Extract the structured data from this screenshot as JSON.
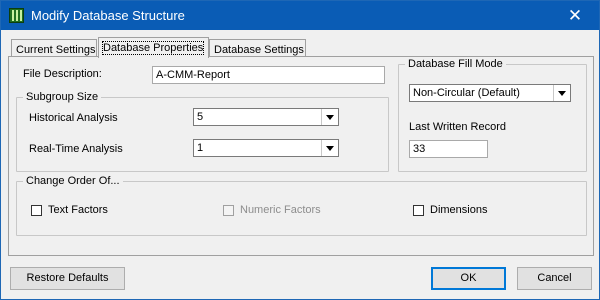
{
  "window": {
    "title": "Modify Database Structure",
    "close_glyph": "✕"
  },
  "tabs": [
    {
      "label": "Current Settings"
    },
    {
      "label": "Database Properties",
      "active": true
    },
    {
      "label": "Database Settings"
    }
  ],
  "file_description": {
    "label": "File Description:",
    "value": "A-CMM-Report"
  },
  "subgroup_size": {
    "title": "Subgroup Size",
    "historical_label": "Historical Analysis",
    "historical_value": "5",
    "realtime_label": "Real-Time Analysis",
    "realtime_value": "1"
  },
  "fill_mode": {
    "title": "Database Fill Mode",
    "selected": "Non-Circular (Default)",
    "last_written_label": "Last Written Record",
    "last_written_value": "33"
  },
  "change_order": {
    "title": "Change Order Of...",
    "text_factors": "Text Factors",
    "numeric_factors": "Numeric Factors",
    "dimensions": "Dimensions"
  },
  "buttons": {
    "restore_defaults": "Restore Defaults",
    "ok": "OK",
    "cancel": "Cancel"
  },
  "icons": {
    "app": "database-bars-icon",
    "close": "close-icon",
    "dropdown": "chevron-down-icon"
  },
  "colors": {
    "titlebar": "#0a5cb5",
    "dialog_bg": "#f0f0f0",
    "focus_border": "#0078d7"
  }
}
